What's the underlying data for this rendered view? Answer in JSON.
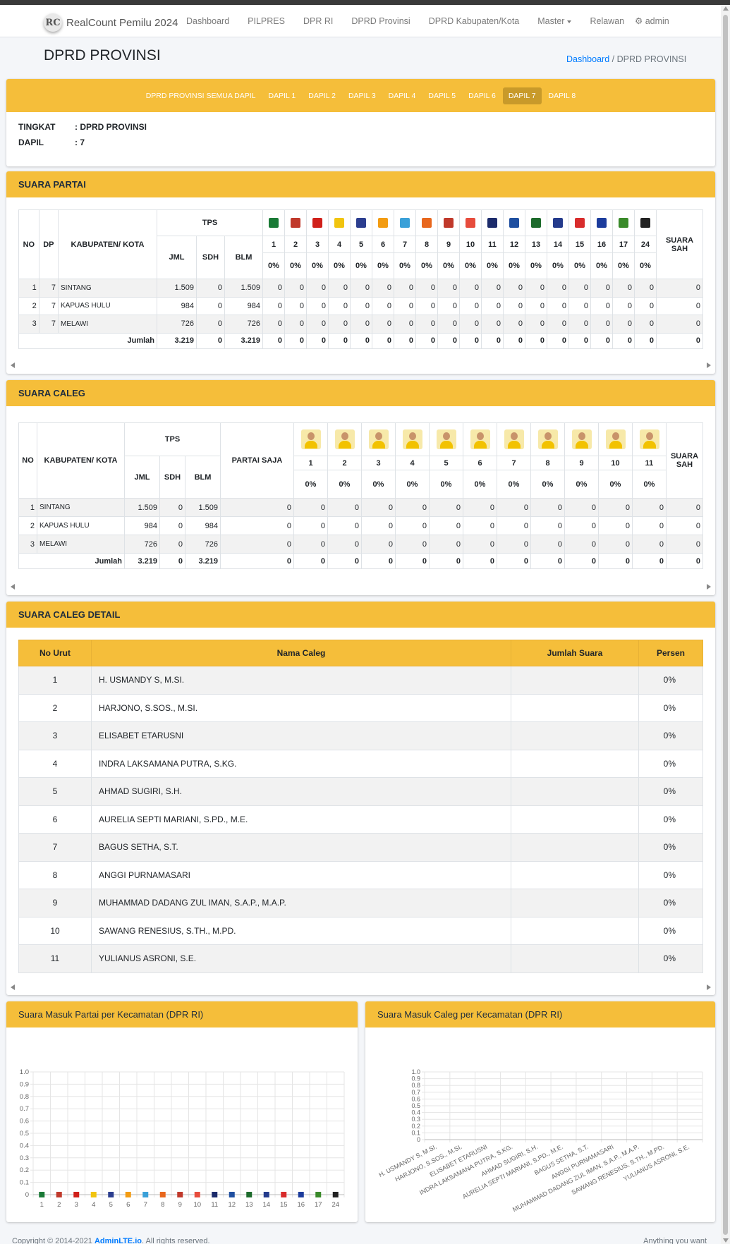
{
  "nav": {
    "brand_logo": "RC",
    "brand": "RealCount Pemilu 2024",
    "items": [
      "Dashboard",
      "PILPRES",
      "DPR RI",
      "DPRD Provinsi",
      "DPRD Kabupaten/Kota",
      "Master",
      "Relawan"
    ],
    "user": "admin"
  },
  "header": {
    "title": "DPRD PROVINSI",
    "crumb_home": "Dashboard",
    "crumb_current": "DPRD PROVINSI"
  },
  "tabs": {
    "items": [
      "DPRD PROVINSI SEMUA DAPIL",
      "DAPIL 1",
      "DAPIL 2",
      "DAPIL 3",
      "DAPIL 4",
      "DAPIL 5",
      "DAPIL 6",
      "DAPIL 7",
      "DAPIL 8"
    ],
    "active_index": 7
  },
  "info": {
    "rows": [
      {
        "k": "TINGKAT",
        "v": ": DPRD PROVINSI"
      },
      {
        "k": "DAPIL",
        "v": ": 7"
      }
    ]
  },
  "suara_partai": {
    "title": "SUARA PARTAI",
    "headers": {
      "no": "NO",
      "dp": "DP",
      "kab": "KABUPATEN/ KOTA",
      "tps": "TPS",
      "jml": "JML",
      "sdh": "SDH",
      "blm": "BLM",
      "sah": "SUARA SAH"
    },
    "parties": [
      {
        "no": "1",
        "color": "#1a7a36"
      },
      {
        "no": "2",
        "color": "#c0392b"
      },
      {
        "no": "3",
        "color": "#d0201a"
      },
      {
        "no": "4",
        "color": "#f1c40f"
      },
      {
        "no": "5",
        "color": "#2c3e8f"
      },
      {
        "no": "6",
        "color": "#f39c12"
      },
      {
        "no": "7",
        "color": "#3aa0d8"
      },
      {
        "no": "8",
        "color": "#e8671d"
      },
      {
        "no": "9",
        "color": "#c0392b"
      },
      {
        "no": "10",
        "color": "#e74c3c"
      },
      {
        "no": "11",
        "color": "#1c2b6b"
      },
      {
        "no": "12",
        "color": "#1f4fa0"
      },
      {
        "no": "13",
        "color": "#1d6b2c"
      },
      {
        "no": "14",
        "color": "#243b8c"
      },
      {
        "no": "15",
        "color": "#d82c2c"
      },
      {
        "no": "16",
        "color": "#1c3c9c"
      },
      {
        "no": "17",
        "color": "#3a8a2a"
      },
      {
        "no": "24",
        "color": "#222222"
      }
    ],
    "pct": "0%",
    "rows": [
      {
        "no": "1",
        "dp": "7",
        "kab": "SINTANG",
        "jml": "1.509",
        "sdh": "0",
        "blm": "1.509"
      },
      {
        "no": "2",
        "dp": "7",
        "kab": "KAPUAS HULU",
        "jml": "984",
        "sdh": "0",
        "blm": "984"
      },
      {
        "no": "3",
        "dp": "7",
        "kab": "MELAWI",
        "jml": "726",
        "sdh": "0",
        "blm": "726"
      }
    ],
    "sum": {
      "label": "Jumlah",
      "jml": "3.219",
      "sdh": "0",
      "blm": "3.219"
    },
    "zero": "0"
  },
  "suara_caleg": {
    "title": "SUARA CALEG",
    "headers": {
      "no": "NO",
      "kab": "KABUPATEN/ KOTA",
      "tps": "TPS",
      "jml": "JML",
      "sdh": "SDH",
      "blm": "BLM",
      "partai": "PARTAI SAJA",
      "sah": "SUARA SAH"
    },
    "nums": [
      "1",
      "2",
      "3",
      "4",
      "5",
      "6",
      "7",
      "8",
      "9",
      "10",
      "11"
    ]
  },
  "detail": {
    "title": "SUARA CALEG DETAIL",
    "headers": [
      "No Urut",
      "Nama Caleg",
      "Jumlah Suara",
      "Persen"
    ],
    "rows": [
      {
        "no": "1",
        "nama": "H. USMANDY S, M.SI.",
        "suara": "",
        "persen": "0%"
      },
      {
        "no": "2",
        "nama": "HARJONO, S.SOS., M.SI.",
        "suara": "",
        "persen": "0%"
      },
      {
        "no": "3",
        "nama": "ELISABET ETARUSNI",
        "suara": "",
        "persen": "0%"
      },
      {
        "no": "4",
        "nama": "INDRA LAKSAMANA PUTRA, S.KG.",
        "suara": "",
        "persen": "0%"
      },
      {
        "no": "5",
        "nama": "AHMAD SUGIRI, S.H.",
        "suara": "",
        "persen": "0%"
      },
      {
        "no": "6",
        "nama": "AURELIA SEPTI MARIANI, S.PD., M.E.",
        "suara": "",
        "persen": "0%"
      },
      {
        "no": "7",
        "nama": "BAGUS SETHA, S.T.",
        "suara": "",
        "persen": "0%"
      },
      {
        "no": "8",
        "nama": "ANGGI PURNAMASARI",
        "suara": "",
        "persen": "0%"
      },
      {
        "no": "9",
        "nama": "MUHAMMAD DADANG ZUL IMAN, S.A.P., M.A.P.",
        "suara": "",
        "persen": "0%"
      },
      {
        "no": "10",
        "nama": "SAWANG RENESIUS, S.TH., M.PD.",
        "suara": "",
        "persen": "0%"
      },
      {
        "no": "11",
        "nama": "YULIANUS ASRONI, S.E.",
        "suara": "",
        "persen": "0%"
      }
    ]
  },
  "charts": {
    "partai_title": "Suara Masuk Partai per Kecamatan (DPR RI)",
    "caleg_title": "Suara Masuk Caleg per Kecamatan (DPR RI)"
  },
  "chart_data": [
    {
      "type": "bar",
      "title": "",
      "categories": [
        "1",
        "2",
        "3",
        "4",
        "5",
        "6",
        "7",
        "8",
        "9",
        "10",
        "11",
        "12",
        "13",
        "14",
        "15",
        "16",
        "17",
        "24"
      ],
      "values": [
        0,
        0,
        0,
        0,
        0,
        0,
        0,
        0,
        0,
        0,
        0,
        0,
        0,
        0,
        0,
        0,
        0,
        0
      ],
      "ylim": [
        0,
        1.0
      ],
      "yticks": [
        "0",
        "0.1",
        "0.2",
        "0.3",
        "0.4",
        "0.5",
        "0.6",
        "0.7",
        "0.8",
        "0.9",
        "1.0"
      ],
      "grid": true
    },
    {
      "type": "bar",
      "title": "",
      "categories": [
        "H. USMANDY S, M.SI.",
        "HARJONO, S.SOS., M.SI.",
        "ELISABET ETARUSNI",
        "INDRA LAKSAMANA PUTRA, S.KG.",
        "AHMAD SUGIRI, S.H.",
        "AURELIA SEPTI MARIANI, S.PD., M.E.",
        "BAGUS SETHA, S.T.",
        "ANGGI PURNAMASARI",
        "MUHAMMAD DADANG ZUL IMAN, S.A.P., M.A.P.",
        "SAWANG RENESIUS, S.TH., M.PD.",
        "YULIANUS ASRONI, S.E."
      ],
      "values": [
        0,
        0,
        0,
        0,
        0,
        0,
        0,
        0,
        0,
        0,
        0
      ],
      "ylim": [
        0,
        1.0
      ],
      "yticks": [
        "0",
        "0.1",
        "0.2",
        "0.3",
        "0.4",
        "0.5",
        "0.6",
        "0.7",
        "0.8",
        "0.9",
        "1.0"
      ],
      "grid": true
    }
  ],
  "footer": {
    "copy": "Copyright © 2014-2021 ",
    "link": "AdminLTE.io",
    "rest": ". All rights reserved.",
    "right": "Anything you want"
  }
}
